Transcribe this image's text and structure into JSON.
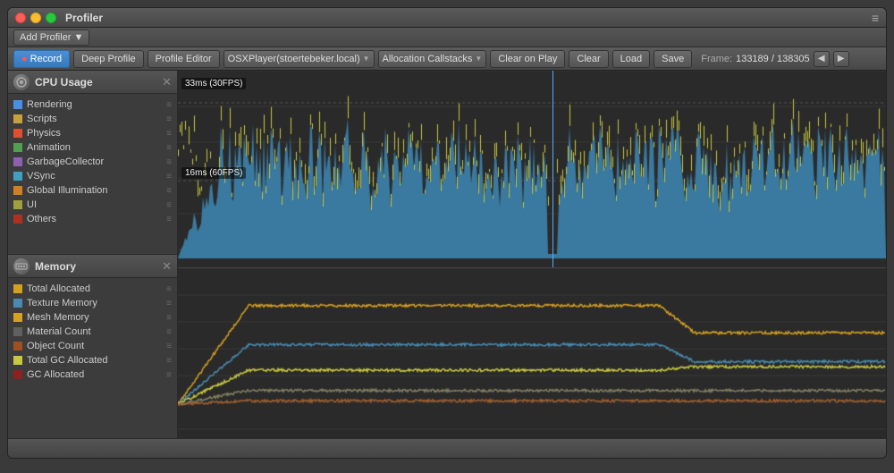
{
  "window": {
    "title": "Profiler",
    "traffic_lights": [
      "red",
      "yellow",
      "green"
    ]
  },
  "add_profiler": {
    "button_label": "Add Profiler",
    "dropdown_arrow": "▼"
  },
  "toolbar": {
    "record_label": "Record",
    "deep_profile_label": "Deep Profile",
    "profile_editor_label": "Profile Editor",
    "target_label": "OSXPlayer(stoertebeker.local)",
    "allocation_label": "Allocation Callstacks",
    "clear_on_play_label": "Clear on Play",
    "clear_label": "Clear",
    "load_label": "Load",
    "save_label": "Save",
    "frame_label": "Frame:",
    "frame_value": "133189 / 138305",
    "nav_prev": "◀",
    "nav_next": "▶",
    "record_icon": "●"
  },
  "cpu_panel": {
    "title": "CPU Usage",
    "close": "✕",
    "legend": [
      {
        "label": "Rendering",
        "color": "#4a90e2"
      },
      {
        "label": "Scripts",
        "color": "#c8a040"
      },
      {
        "label": "Physics",
        "color": "#e05030"
      },
      {
        "label": "Animation",
        "color": "#50a050"
      },
      {
        "label": "GarbageCollector",
        "color": "#9060b0"
      },
      {
        "label": "VSync",
        "color": "#40a0c0"
      },
      {
        "label": "Global Illumination",
        "color": "#d08020"
      },
      {
        "label": "UI",
        "color": "#a0a040"
      },
      {
        "label": "Others",
        "color": "#b03020"
      }
    ],
    "labels": {
      "fps30": "33ms (30FPS)",
      "fps60": "16ms (60FPS)"
    },
    "chart": {
      "bg_color": "#2a2a2a",
      "grid_color": "#3a3a3a",
      "bar_color_top": "#c8c840",
      "bar_color_bottom": "#4a8ab0",
      "cursor_color": "#5ab4f0",
      "cursor_x_percent": 53
    }
  },
  "memory_panel": {
    "title": "Memory",
    "close": "✕",
    "legend": [
      {
        "label": "Total Allocated",
        "color": "#d4a020"
      },
      {
        "label": "Texture Memory",
        "color": "#4a8ab0"
      },
      {
        "label": "Mesh Memory",
        "color": "#d4a020"
      },
      {
        "label": "Material Count",
        "color": "#606060"
      },
      {
        "label": "Object Count",
        "color": "#a05020"
      },
      {
        "label": "Total GC Allocated",
        "color": "#c8c840"
      },
      {
        "label": "GC Allocated",
        "color": "#902020"
      }
    ]
  }
}
